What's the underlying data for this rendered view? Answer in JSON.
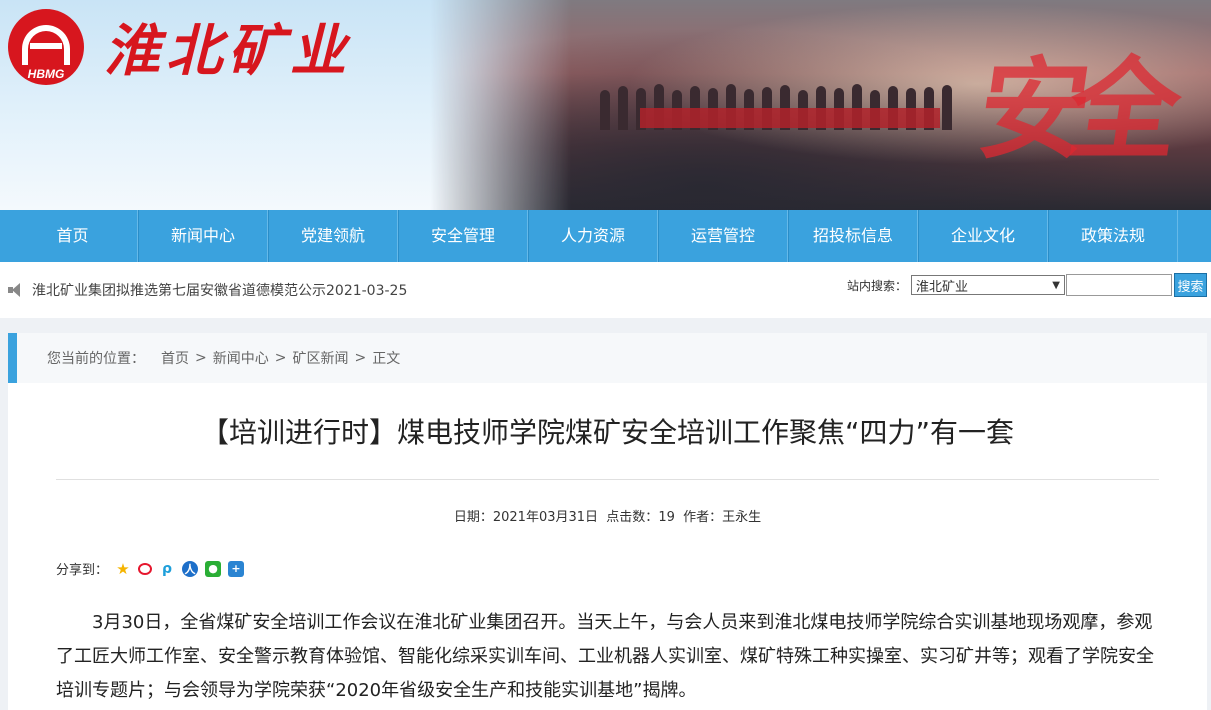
{
  "brand": {
    "logo_abbr": "HBMG",
    "name": "淮北矿业",
    "banner_graphic_text": "安全"
  },
  "nav": {
    "items": [
      "首页",
      "新闻中心",
      "党建领航",
      "安全管理",
      "人力资源",
      "运营管控",
      "招投标信息",
      "企业文化",
      "政策法规"
    ]
  },
  "ticker": {
    "text": "淮北矿业集团拟推选第七届安徽省道德模范公示2021-03-25"
  },
  "search": {
    "label": "站内搜索：",
    "selected": "淮北矿业",
    "input_value": "",
    "button": "搜索"
  },
  "breadcrumb": {
    "prefix": "您当前的位置：",
    "items": [
      "首页",
      ">",
      "新闻中心",
      ">",
      "矿区新闻",
      ">",
      "正文"
    ]
  },
  "article": {
    "title": "【培训进行时】煤电技师学院煤矿安全培训工作聚焦“四力”有一套",
    "meta": {
      "date_label": "日期：",
      "date": "2021年03月31日",
      "clicks_label": "点击数：",
      "clicks": "19",
      "author_label": "作者：",
      "author": "王永生"
    },
    "share_label": "分享到：",
    "share_icons": [
      "qzone-icon",
      "weibo-icon",
      "pengyou-icon",
      "renren-icon",
      "wechat-icon",
      "more-share-icon"
    ],
    "paragraph": "3月30日，全省煤矿安全培训工作会议在淮北矿业集团召开。当天上午，与会人员来到淮北煤电技师学院综合实训基地现场观摩，参观了工匠大师工作室、安全警示教育体验馆、智能化综采实训车间、工业机器人实训室、煤矿特殊工种实操室、实习矿井等；观看了学院安全培训专题片；与会领导为学院荣获“2020年省级安全生产和技能实训基地”揭牌。"
  },
  "colors": {
    "brand_red": "#d7161e",
    "nav_blue": "#3aa2de"
  }
}
